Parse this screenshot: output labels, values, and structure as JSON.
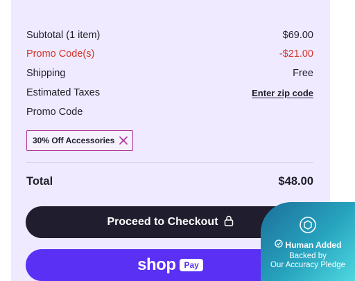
{
  "summary": {
    "subtotal_label": "Subtotal (1 item)",
    "subtotal_value": "$69.00",
    "promo_label": "Promo Code(s)",
    "promo_value": "-$21.00",
    "shipping_label": "Shipping",
    "shipping_value": "Free",
    "taxes_label": "Estimated Taxes",
    "taxes_link": "Enter zip code",
    "promo_code_label": "Promo Code",
    "applied_code": "30% Off Accessories",
    "total_label": "Total",
    "total_value": "$48.00"
  },
  "buttons": {
    "checkout_label": "Proceed to Checkout",
    "shop_label": "shop",
    "pay_label": "Pay"
  },
  "badge": {
    "title": "Human Added",
    "line1": "Backed by",
    "line2": "Our Accuracy Pledge"
  },
  "colors": {
    "panel_bg": "#efeaff",
    "promo_red": "#d2352a",
    "chip_border": "#b1379a",
    "checkout_bg": "#1f1d2e",
    "shop_purple": "#5a31f4",
    "badge_teal": "#27a3be"
  },
  "icons": {
    "remove_code": "close-icon",
    "checkout": "lock-icon",
    "badge_logo": "chat-bubble-icon",
    "badge_check": "check-circle-icon"
  }
}
